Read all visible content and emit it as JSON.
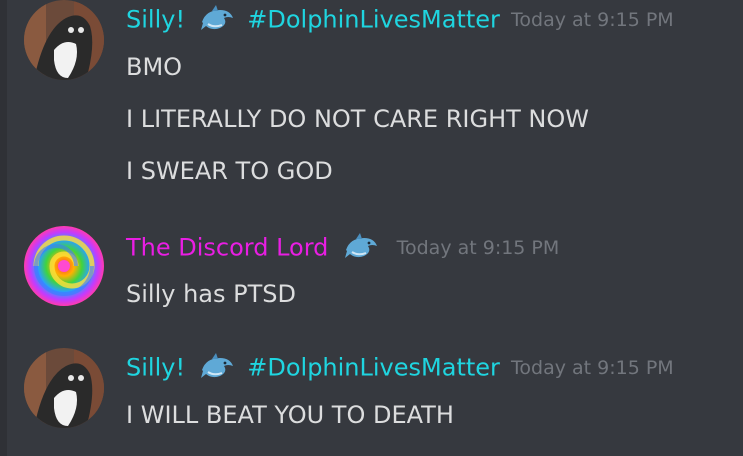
{
  "colors": {
    "background": "#36393f",
    "silly_name": "#1fd5e0",
    "lord_name": "#e91ee3",
    "timestamp": "#72767d",
    "message_text": "#dcddde"
  },
  "messages": [
    {
      "author": "Silly!",
      "author_suffix": "#DolphinLivesMatter",
      "emoji": "dolphin-icon",
      "timestamp": "Today at 9:15 PM",
      "lines": [
        "BMO",
        "I LITERALLY DO NOT CARE RIGHT NOW",
        "I SWEAR TO GOD"
      ]
    },
    {
      "author": "The Discord Lord",
      "emoji": "dolphin-icon",
      "timestamp": "Today at 9:15 PM",
      "lines": [
        "Silly has PTSD"
      ]
    },
    {
      "author": "Silly!",
      "author_suffix": "#DolphinLivesMatter",
      "emoji": "dolphin-icon",
      "timestamp": "Today at 9:15 PM",
      "lines": [
        "I WILL BEAT YOU TO DEATH"
      ]
    }
  ]
}
